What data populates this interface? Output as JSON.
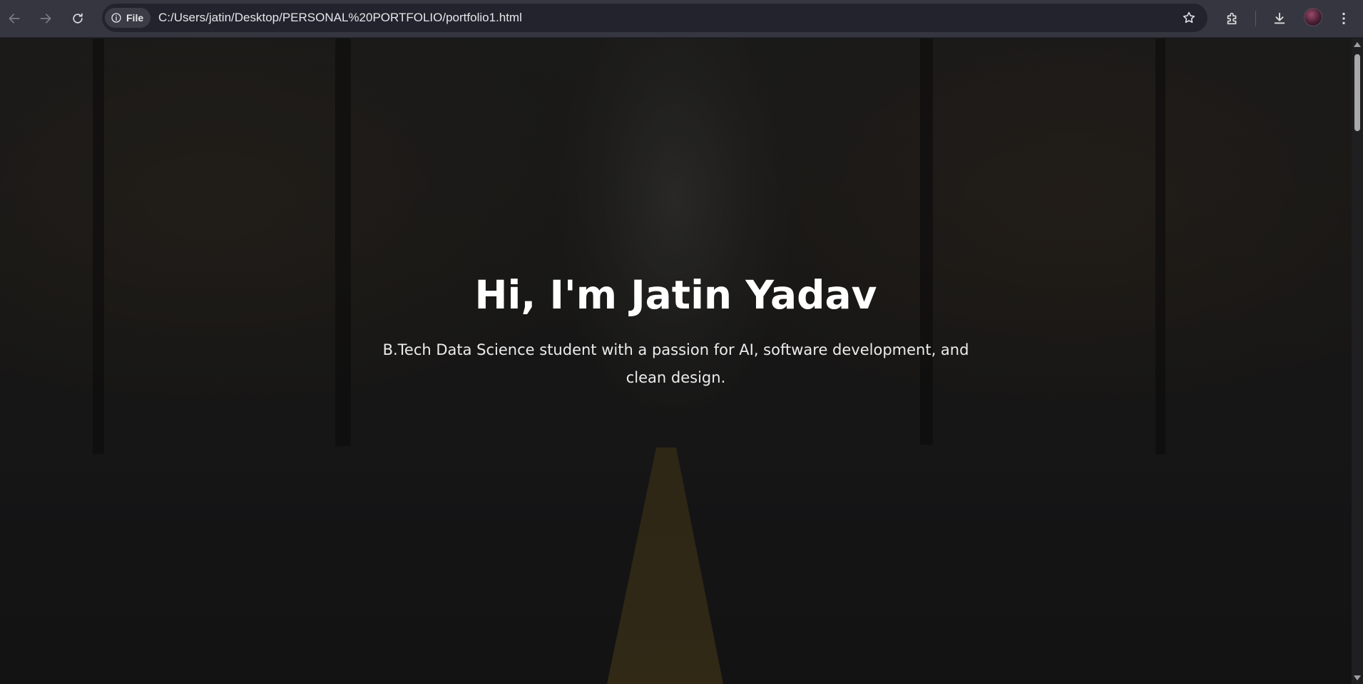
{
  "browser": {
    "back_icon": "arrow-left-icon",
    "forward_icon": "arrow-right-icon",
    "reload_icon": "reload-icon",
    "site_info_icon": "info-icon",
    "site_chip_label": "File",
    "url": "C:/Users/jatin/Desktop/PERSONAL%20PORTFOLIO/portfolio1.html",
    "bookmark_icon": "star-icon",
    "extensions_icon": "puzzle-icon",
    "downloads_icon": "download-icon",
    "menu_icon": "more-vertical-icon",
    "accent_color": "#35363f"
  },
  "page": {
    "hero": {
      "title": "Hi, I'm Jatin Yadav",
      "subtitle": "B.Tech Data Science student with a passion for AI, software development, and clean design."
    },
    "scroll_position": 0
  }
}
